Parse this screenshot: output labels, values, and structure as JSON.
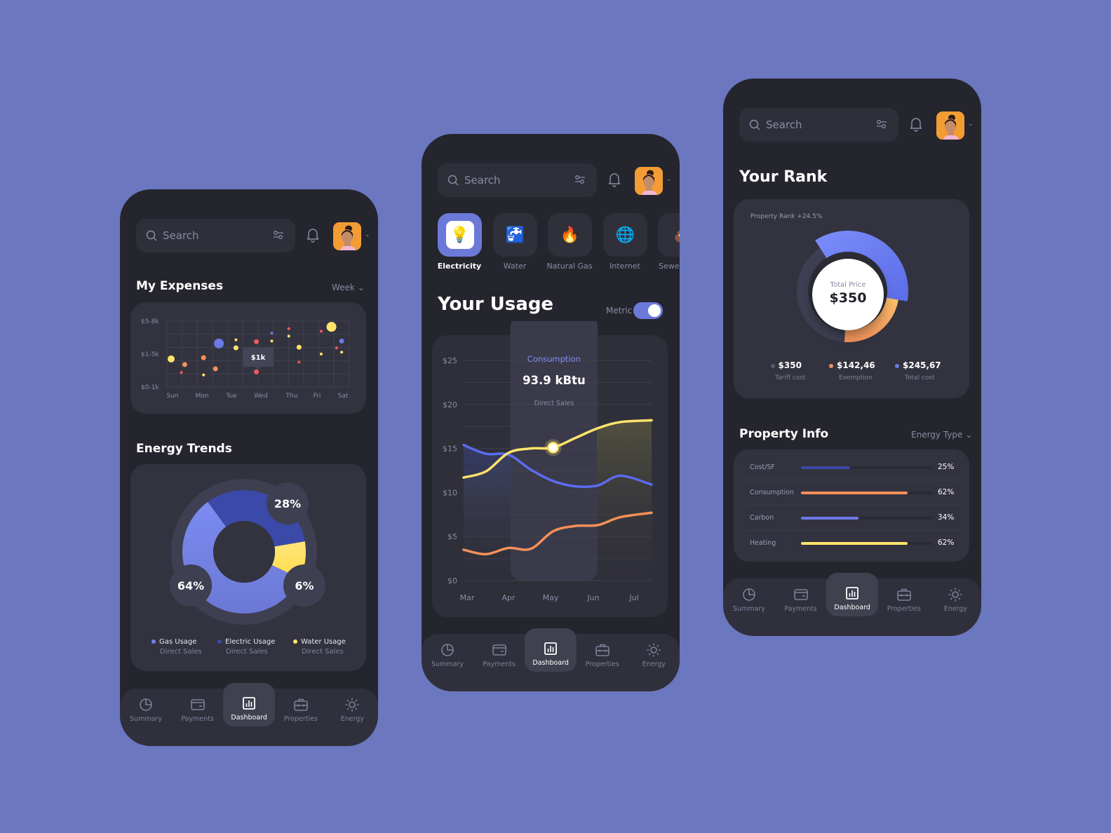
{
  "colors": {
    "background": "#6b77bf",
    "phone": "#25252e",
    "card": "#33333f",
    "accent_blue": "#6b7ad9",
    "dark_blue": "#3b4aa8",
    "light_blue": "#7383e6",
    "yellow": "#ffe46b",
    "orange": "#f4915a",
    "red": "#f05b5b",
    "gray": "#5a5b6b"
  },
  "search": {
    "placeholder": "Search"
  },
  "navbar": {
    "items": [
      {
        "label": "Summary",
        "icon": "pie-chart-icon"
      },
      {
        "label": "Payments",
        "icon": "credit-card-icon"
      },
      {
        "label": "Dashboard",
        "icon": "bar-chart-icon",
        "active": true
      },
      {
        "label": "Properties",
        "icon": "briefcase-icon"
      },
      {
        "label": "Energy",
        "icon": "sun-icon"
      }
    ]
  },
  "screen1": {
    "expenses": {
      "title": "My Expenses",
      "period": "Week",
      "tooltip": "$1k"
    },
    "energy": {
      "title": "Energy Trends",
      "legend": [
        {
          "label": "Gas Usage",
          "sub": "Direct Sales"
        },
        {
          "label": "Electric Usage",
          "sub": "Direct Sales"
        },
        {
          "label": "Water Usage",
          "sub": "Direct Sales"
        }
      ]
    }
  },
  "screen2": {
    "utilities": [
      {
        "label": "Electricity",
        "icon": "💡",
        "active": true
      },
      {
        "label": "Water",
        "icon": "🚰"
      },
      {
        "label": "Natural Gas",
        "icon": "🔥"
      },
      {
        "label": "Internet",
        "icon": "🌐"
      },
      {
        "label": "Sewer",
        "icon": "💩"
      }
    ],
    "title": "Your Usage",
    "metric_label": "Metric",
    "metric_on": true,
    "tooltip": {
      "title": "Consumption",
      "value": "93.9 kBtu",
      "sub": "Direct Sales"
    }
  },
  "screen3": {
    "rank": {
      "title": "Your Rank",
      "subtitle": "Property Rank +24.5%",
      "center_label": "Total Price",
      "center_value": "$350",
      "legend": [
        {
          "value": "$350",
          "label": "Tariff cost"
        },
        {
          "value": "$142,46",
          "label": "Exemption"
        },
        {
          "value": "$245,67",
          "label": "Total cost"
        }
      ]
    },
    "property": {
      "title": "Property Info",
      "filter": "Energy Type",
      "rows": [
        {
          "label": "Cost/SF",
          "value": "25%",
          "percent": 25
        },
        {
          "label": "Consumption",
          "value": "62%",
          "percent": 62
        },
        {
          "label": "Carbon",
          "value": "34%",
          "percent": 34
        },
        {
          "label": "Heating",
          "value": "62%",
          "percent": 62
        }
      ]
    }
  },
  "chart_data": [
    {
      "type": "scatter",
      "title": "My Expenses",
      "categories": [
        "Sun",
        "Mon",
        "Tue",
        "Wed",
        "Thu",
        "Fri",
        "Sat"
      ],
      "y_tick_labels": [
        "$5-8k",
        "$1-5k",
        "$0-1k"
      ],
      "grid": true,
      "points": [
        {
          "x": 0.0,
          "y": 2.05,
          "size": "medium",
          "color": "yellow"
        },
        {
          "x": 0.4,
          "y": 1.6,
          "size": "small",
          "color": "orange"
        },
        {
          "x": 0.3,
          "y": 0.95,
          "size": "tiny",
          "color": "red"
        },
        {
          "x": 0.95,
          "y": 2.15,
          "size": "small",
          "color": "orange"
        },
        {
          "x": 0.95,
          "y": 0.75,
          "size": "tiny",
          "color": "yellow"
        },
        {
          "x": 1.3,
          "y": 1.25,
          "size": "small",
          "color": "orange"
        },
        {
          "x": 1.4,
          "y": 3.3,
          "size": "large",
          "color": "blue"
        },
        {
          "x": 1.9,
          "y": 3.6,
          "size": "tiny",
          "color": "yellow"
        },
        {
          "x": 1.9,
          "y": 2.95,
          "size": "small",
          "color": "yellow"
        },
        {
          "x": 2.5,
          "y": 3.45,
          "size": "small",
          "color": "red"
        },
        {
          "x": 2.5,
          "y": 1.0,
          "size": "small",
          "color": "red"
        },
        {
          "x": 2.95,
          "y": 3.5,
          "size": "tiny",
          "color": "yellow"
        },
        {
          "x": 2.95,
          "y": 4.15,
          "size": "tiny",
          "color": "blue"
        },
        {
          "x": 3.45,
          "y": 4.5,
          "size": "tiny",
          "color": "red"
        },
        {
          "x": 3.45,
          "y": 3.9,
          "size": "tiny",
          "color": "yellow"
        },
        {
          "x": 3.75,
          "y": 3.0,
          "size": "small",
          "color": "yellow"
        },
        {
          "x": 3.75,
          "y": 1.8,
          "size": "tiny",
          "color": "red"
        },
        {
          "x": 4.4,
          "y": 4.3,
          "size": "tiny",
          "color": "red"
        },
        {
          "x": 4.4,
          "y": 2.45,
          "size": "tiny",
          "color": "yellow"
        },
        {
          "x": 4.7,
          "y": 4.65,
          "size": "large",
          "color": "yellow"
        },
        {
          "x": 4.85,
          "y": 2.95,
          "size": "tiny",
          "color": "red"
        },
        {
          "x": 5.0,
          "y": 3.5,
          "size": "small",
          "color": "blue"
        },
        {
          "x": 5.0,
          "y": 2.6,
          "size": "tiny",
          "color": "yellow"
        }
      ],
      "xlim": [
        0,
        5.1
      ],
      "ylim": [
        0,
        5
      ]
    },
    {
      "type": "pie",
      "title": "Energy Trends",
      "labels": [
        "Electric Usage",
        "Water Usage",
        "Gas Usage"
      ],
      "values": [
        28,
        6,
        64
      ],
      "value_labels": [
        "28%",
        "6%",
        "64%"
      ],
      "donut": true
    },
    {
      "type": "line",
      "title": "Your Usage",
      "categories": [
        "Mar",
        "Apr",
        "May",
        "Jun",
        "Jul"
      ],
      "y_tick_labels": [
        "$0",
        "$5",
        "$10",
        "$15",
        "$20",
        "$25"
      ],
      "ylim": [
        0,
        25
      ],
      "grid": true,
      "highlighted": "May",
      "series": [
        {
          "name": "Blue",
          "color": "blue",
          "values": [
            15.4,
            14.4,
            14.3,
            12.6,
            11.3,
            10.7,
            10.8,
            11.9,
            10.9
          ]
        },
        {
          "name": "Yellow",
          "color": "yellow",
          "values": [
            11.7,
            12.4,
            14.5,
            15.0,
            15.1,
            16.2,
            17.3,
            18.0,
            18.2
          ]
        },
        {
          "name": "Orange",
          "color": "orange",
          "values": [
            3.5,
            3.0,
            3.7,
            3.6,
            5.6,
            6.2,
            6.3,
            7.2,
            7.7
          ]
        }
      ],
      "x_points": [
        0,
        0.5,
        1,
        1.5,
        2,
        2.5,
        3,
        3.5,
        4.2
      ],
      "marker": {
        "x": 2,
        "series": "Yellow",
        "value": 15.1
      }
    },
    {
      "type": "pie",
      "title": "Property Rank",
      "labels": [
        "Tariff cost",
        "Exemption",
        "Total cost"
      ],
      "values": [
        350,
        142.46,
        245.67
      ],
      "donut": true
    }
  ]
}
